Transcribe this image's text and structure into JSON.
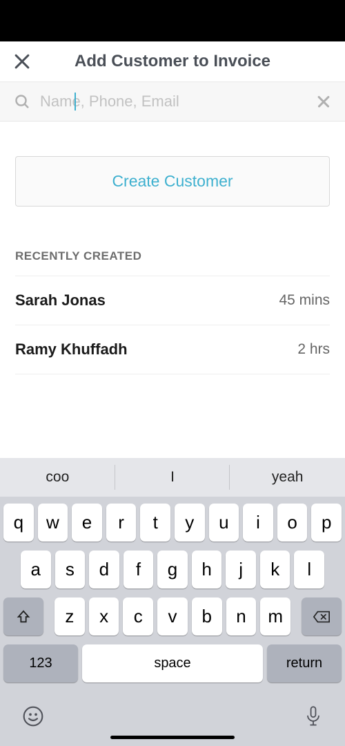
{
  "header": {
    "title": "Add Customer to Invoice"
  },
  "search": {
    "placeholder": "Name, Phone, Email",
    "value": ""
  },
  "actions": {
    "create_label": "Create Customer"
  },
  "recent": {
    "section_label": "RECENTLY CREATED",
    "items": [
      {
        "name": "Sarah Jonas",
        "time": "45 mins"
      },
      {
        "name": "Ramy Khuffadh",
        "time": "2 hrs"
      }
    ]
  },
  "keyboard": {
    "suggestions": [
      "coo",
      "I",
      "yeah"
    ],
    "row1": [
      "q",
      "w",
      "e",
      "r",
      "t",
      "y",
      "u",
      "i",
      "o",
      "p"
    ],
    "row2": [
      "a",
      "s",
      "d",
      "f",
      "g",
      "h",
      "j",
      "k",
      "l"
    ],
    "row3": [
      "z",
      "x",
      "c",
      "v",
      "b",
      "n",
      "m"
    ],
    "numeric_label": "123",
    "space_label": "space",
    "return_label": "return"
  }
}
